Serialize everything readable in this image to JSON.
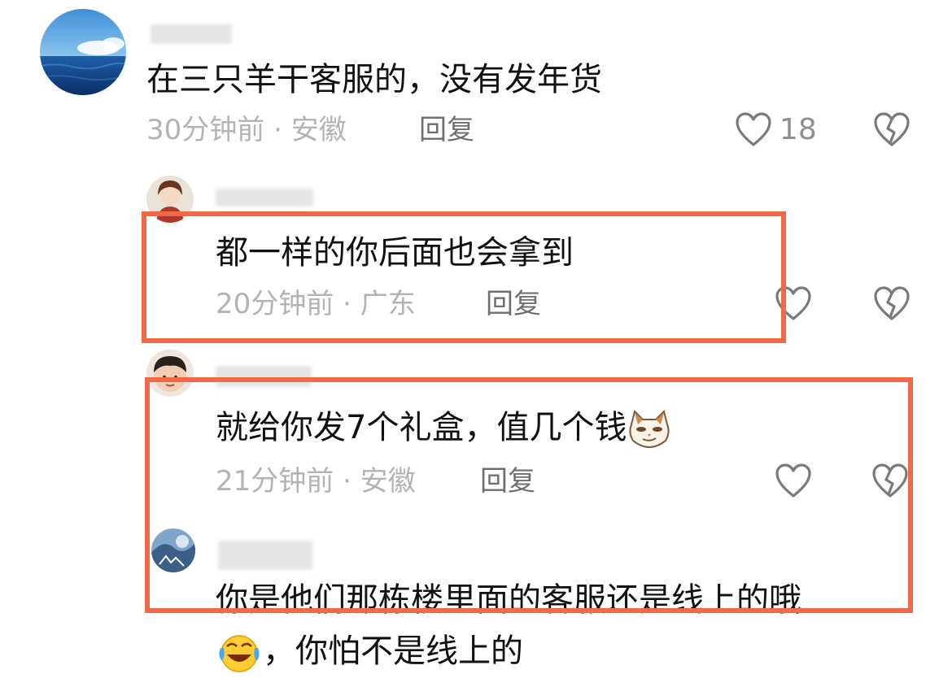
{
  "comments": [
    {
      "text": "在三只羊干客服的，没有发年货",
      "time": "30分钟前",
      "location": "安徽",
      "reply_label": "回复",
      "likes": "18"
    },
    {
      "text": "都一样的你后面也会拿到",
      "time": "20分钟前",
      "location": "广东",
      "reply_label": "回复"
    },
    {
      "text": "就给你发7个礼盒，值几个钱",
      "time": "21分钟前",
      "location": "安徽",
      "reply_label": "回复"
    },
    {
      "text_line1": "你是他们那栋楼里面的客服还是线上的哦",
      "text_line2": "，你怕不是线上的"
    }
  ],
  "separator": "·",
  "icons": {
    "like": "heart-outline-icon",
    "dislike": "broken-heart-icon"
  },
  "colors": {
    "highlight_box": "#f06a45",
    "meta": "#b3b3b3",
    "reply": "#6f6f6f",
    "text": "#111111"
  }
}
